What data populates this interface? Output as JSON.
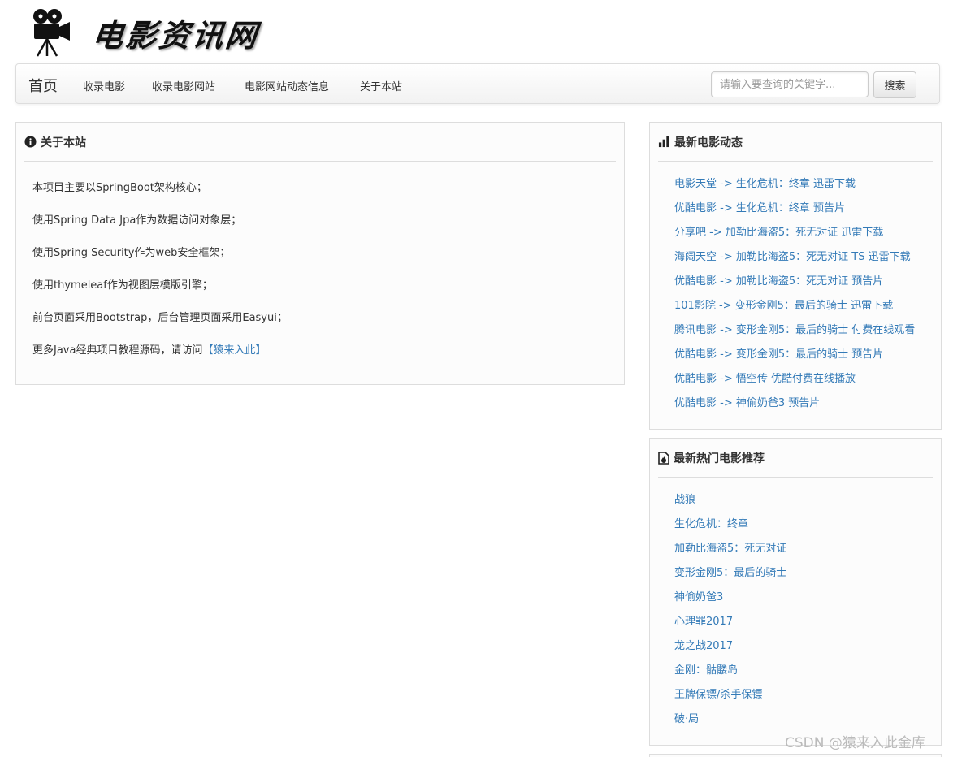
{
  "logo": {
    "text": "电影资讯网",
    "icon": "film-camera-icon"
  },
  "nav": {
    "brand": "首页",
    "items": [
      "收录电影",
      "收录电影网站",
      "电影网站动态信息",
      "关于本站"
    ]
  },
  "search": {
    "placeholder": "请输入要查询的关键字...",
    "button_label": "搜索"
  },
  "about": {
    "icon": "info-circle-icon",
    "title": "关于本站",
    "lines": [
      "本项目主要以SpringBoot架构核心；",
      "使用Spring Data Jpa作为数据访问对象层；",
      "使用Spring Security作为web安全框架；",
      "使用thymeleaf作为视图层模版引擎；",
      "前台页面采用Bootstrap，后台管理页面采用Easyui；",
      "更多Java经典项目教程源码，请访问"
    ],
    "link_text": "【猿来入此】"
  },
  "latest": {
    "icon": "bar-chart-icon",
    "title": "最新电影动态",
    "items": [
      "电影天堂 -> 生化危机：终章 迅雷下载",
      "优酷电影 -> 生化危机：终章 预告片",
      "分享吧 -> 加勒比海盗5：死无对证 迅雷下载",
      "海阔天空 -> 加勒比海盗5：死无对证 TS 迅雷下载",
      "优酷电影 -> 加勒比海盗5：死无对证 预告片",
      "101影院 -> 变形金刚5：最后的骑士 迅雷下载",
      "腾讯电影 -> 变形金刚5：最后的骑士 付费在线观看",
      "优酷电影 -> 变形金刚5：最后的骑士 预告片",
      "优酷电影 -> 悟空传 优酷付费在线播放",
      "优酷电影 -> 神偷奶爸3 预告片"
    ]
  },
  "hot": {
    "icon": "fire-document-icon",
    "title": "最新热门电影推荐",
    "items": [
      "战狼",
      "生化危机：终章",
      "加勒比海盗5：死无对证",
      "变形金刚5：最后的骑士",
      "神偷奶爸3",
      "心理罪2017",
      "龙之战2017",
      "金刚：骷髅岛",
      "王牌保镖/杀手保镖",
      "破·局"
    ]
  },
  "watermark": "CSDN @猿来入此金库",
  "colors": {
    "link": "#337ab7",
    "border": "#dddddd",
    "text": "#333333"
  }
}
